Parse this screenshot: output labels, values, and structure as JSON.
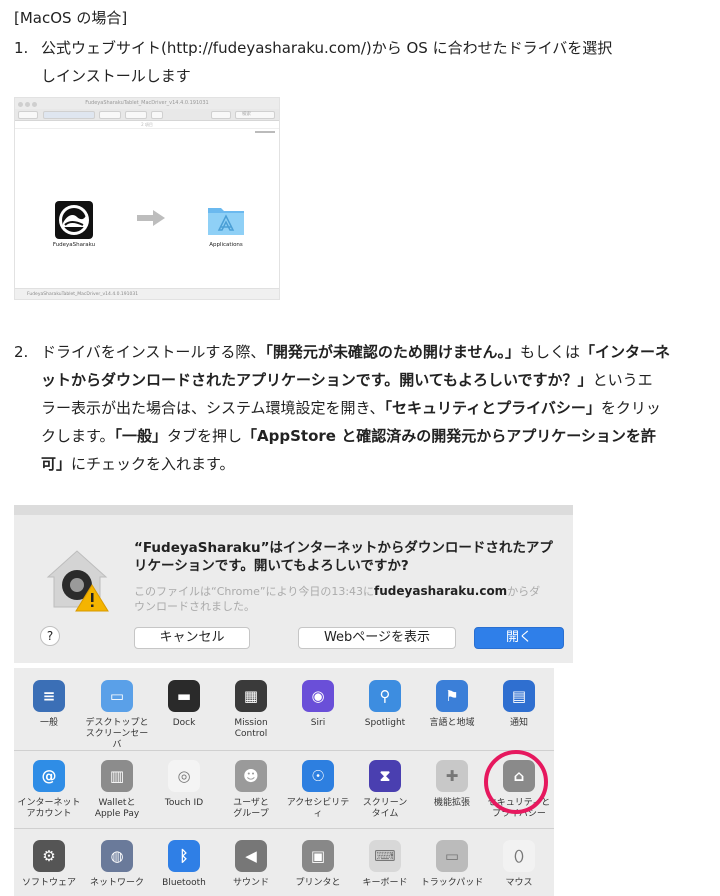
{
  "heading": "[MacOS の場合]",
  "step1": {
    "num": "1.",
    "line1": "公式ウェブサイト(http://fudeyasharaku.com/)から OS に合わせたドライバを選択",
    "line2": "しインストールします"
  },
  "finder": {
    "window_title": "FudeyaSharakuTablet_MacDriver_v14.4.0.191031",
    "path_text": "2 項目",
    "search_placeholder": "検索",
    "app_label": "FudeyaSharaku",
    "folder_label": "Applications",
    "status_text": "FudeyaSharakuTablet_MacDriver_v14.4.0.191031"
  },
  "step2": {
    "num": "2.",
    "l1a": "ドライバをインストールする際、",
    "l1b": "「開発元が未確認のため開けません。」",
    "l1c": "もしくは",
    "l1d": "「インターネ",
    "l2a": "ットからダウンロードされたアプリケーションです。開いてもよろしいですか？」",
    "l2b": "というエ",
    "l3a": "ラー表示が出た場合は、システム環境設定を開き、",
    "l3b": "「セキュリティとプライバシー」",
    "l3c": "をクリッ",
    "l4a": "クします。",
    "l4b": "「一般」",
    "l4c": "タブを押し",
    "l4d": "「AppStore と確認済みの開発元からアプリケーションを許",
    "l5a": "可」",
    "l5b": "にチェックを入れます。"
  },
  "dialog": {
    "title1": "“FudeyaSharaku”はインターネットからダウンロードされたアプ",
    "title2": "リケーションです。開いてもよろしいですか?",
    "sub1a": "このファイルは“Chrome”により今日の13:43に",
    "sub1b": "fudeyasharaku.com",
    "sub1c": "からダ",
    "sub2": "ウンロードされました。",
    "help": "?",
    "cancel": "キャンセル",
    "webpage": "Webページを表示",
    "open": "開く"
  },
  "prefs": {
    "row1": [
      {
        "label": "一般",
        "icon": "general-icon",
        "color": "#3b6fb6"
      },
      {
        "label": "デスクトップと\nスクリーンセーバ",
        "icon": "desktop-icon",
        "color": "#5aa0e8"
      },
      {
        "label": "Dock",
        "icon": "dock-icon",
        "color": "#2a2a2a"
      },
      {
        "label": "Mission\nControl",
        "icon": "mission-control-icon",
        "color": "#3a3a3a"
      },
      {
        "label": "Siri",
        "icon": "siri-icon",
        "color": "#6a4fd8"
      },
      {
        "label": "Spotlight",
        "icon": "spotlight-icon",
        "color": "#3d8de0"
      },
      {
        "label": "言語と地域",
        "icon": "language-icon",
        "color": "#3b7fd8"
      },
      {
        "label": "通知",
        "icon": "notifications-icon",
        "color": "#2f6fd0"
      }
    ],
    "row2": [
      {
        "label": "インターネット\nアカウント",
        "icon": "internet-accounts-icon",
        "color": "#2f8de6"
      },
      {
        "label": "Walletと\nApple Pay",
        "icon": "wallet-icon",
        "color": "#8c8c8c"
      },
      {
        "label": "Touch ID",
        "icon": "touchid-icon",
        "color": "#f4f4f4"
      },
      {
        "label": "ユーザと\nグループ",
        "icon": "users-icon",
        "color": "#9a9a9a"
      },
      {
        "label": "アクセシビリティ",
        "icon": "accessibility-icon",
        "color": "#2d7fe0"
      },
      {
        "label": "スクリーン\nタイム",
        "icon": "screen-time-icon",
        "color": "#4a3fb0"
      },
      {
        "label": "機能拡張",
        "icon": "extensions-icon",
        "color": "#c8c8c8"
      },
      {
        "label": "セキュリティと\nプライバシー",
        "icon": "security-icon",
        "color": "#8a8a8a"
      }
    ],
    "row3": [
      {
        "label": "ソフトウェア",
        "icon": "software-update-icon",
        "color": "#555"
      },
      {
        "label": "ネットワーク",
        "icon": "network-icon",
        "color": "#6a7a9a"
      },
      {
        "label": "Bluetooth",
        "icon": "bluetooth-icon",
        "color": "#2f7fe6"
      },
      {
        "label": "サウンド",
        "icon": "sound-icon",
        "color": "#777"
      },
      {
        "label": "プリンタと",
        "icon": "printer-icon",
        "color": "#888"
      },
      {
        "label": "キーボード",
        "icon": "keyboard-icon",
        "color": "#d8d8d8"
      },
      {
        "label": "トラックパッド",
        "icon": "trackpad-icon",
        "color": "#bbb"
      },
      {
        "label": "マウス",
        "icon": "mouse-icon",
        "color": "#f2f2f2"
      }
    ],
    "highlight_color": "#e6185e"
  }
}
